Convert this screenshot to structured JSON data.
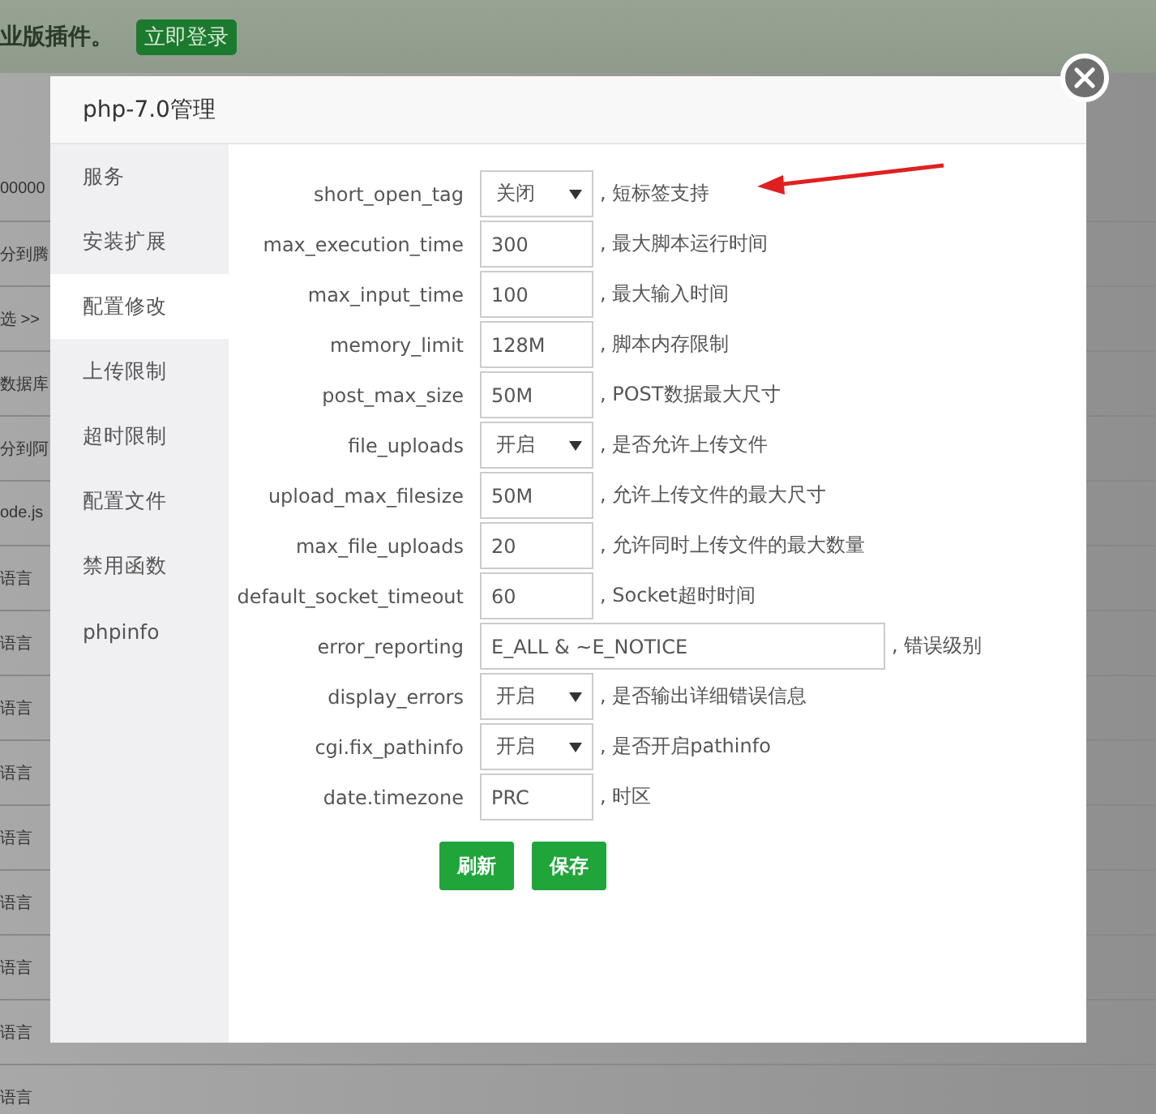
{
  "background_page": {
    "notice_text": "业版插件。",
    "login_button": "立即登录",
    "rows": [
      "00000",
      "分到腾",
      "选 >>",
      "数据库",
      "分到阿",
      "ode.js",
      "语言",
      "语言",
      "语言",
      "语言",
      "语言",
      "语言",
      "语言",
      "语言",
      "语言"
    ]
  },
  "dialog": {
    "title": "php-7.0管理",
    "sidebar": {
      "items": [
        {
          "label": "服务",
          "selected": false
        },
        {
          "label": "安装扩展",
          "selected": false
        },
        {
          "label": "配置修改",
          "selected": true
        },
        {
          "label": "上传限制",
          "selected": false
        },
        {
          "label": "超时限制",
          "selected": false
        },
        {
          "label": "配置文件",
          "selected": false
        },
        {
          "label": "禁用函数",
          "selected": false
        },
        {
          "label": "phpinfo",
          "selected": false
        }
      ]
    },
    "settings": [
      {
        "kind": "select",
        "name": "short_open_tag",
        "value": "关闭",
        "description": ", 短标签支持"
      },
      {
        "kind": "input",
        "name": "max_execution_time",
        "value": "300",
        "description": ", 最大脚本运行时间"
      },
      {
        "kind": "input",
        "name": "max_input_time",
        "value": "100",
        "description": ", 最大输入时间"
      },
      {
        "kind": "input",
        "name": "memory_limit",
        "value": "128M",
        "description": ", 脚本内存限制"
      },
      {
        "kind": "input",
        "name": "post_max_size",
        "value": "50M",
        "description": ", POST数据最大尺寸"
      },
      {
        "kind": "select",
        "name": "file_uploads",
        "value": "开启",
        "description": ", 是否允许上传文件"
      },
      {
        "kind": "input",
        "name": "upload_max_filesize",
        "value": "50M",
        "description": ", 允许上传文件的最大尺寸"
      },
      {
        "kind": "input",
        "name": "max_file_uploads",
        "value": "20",
        "description": ", 允许同时上传文件的最大数量"
      },
      {
        "kind": "input",
        "name": "default_socket_timeout",
        "value": "60",
        "description": ", Socket超时时间"
      },
      {
        "kind": "wide_input",
        "name": "error_reporting",
        "value": "E_ALL & ~E_NOTICE",
        "description": ", 错误级别"
      },
      {
        "kind": "select",
        "name": "display_errors",
        "value": "开启",
        "description": ", 是否输出详细错误信息"
      },
      {
        "kind": "select",
        "name": "cgi.fix_pathinfo",
        "value": "开启",
        "description": ", 是否开启pathinfo"
      },
      {
        "kind": "input",
        "name": "date.timezone",
        "value": "PRC",
        "description": ", 时区"
      }
    ],
    "buttons": [
      "刷新",
      "保存"
    ]
  }
}
